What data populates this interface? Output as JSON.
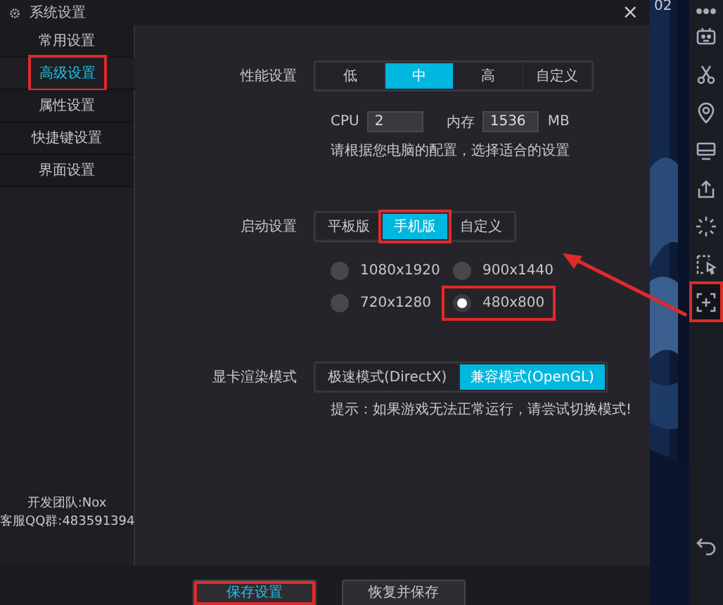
{
  "window": {
    "title": "系统设置",
    "close": "×"
  },
  "sidebar": {
    "items": [
      {
        "label": "常用设置",
        "selected": false,
        "highlighted": false
      },
      {
        "label": "高级设置",
        "selected": true,
        "highlighted": true
      },
      {
        "label": "属性设置",
        "selected": false,
        "highlighted": false
      },
      {
        "label": "快捷键设置",
        "selected": false,
        "highlighted": false
      },
      {
        "label": "界面设置",
        "selected": false,
        "highlighted": false
      }
    ],
    "team": "开发团队:Nox",
    "support": "客服QQ群:483591394"
  },
  "performance": {
    "label": "性能设置",
    "options": [
      {
        "label": "低",
        "selected": false,
        "highlighted": false
      },
      {
        "label": "中",
        "selected": true,
        "highlighted": false
      },
      {
        "label": "高",
        "selected": false,
        "highlighted": false
      },
      {
        "label": "自定义",
        "selected": false,
        "highlighted": false
      }
    ],
    "cpu_label": "CPU",
    "cpu": "2",
    "memory_label": "内存",
    "memory": "1536",
    "memory_unit": "MB",
    "hint": "请根据您电脑的配置，选择适合的设置"
  },
  "startup": {
    "label": "启动设置",
    "options": [
      {
        "label": "平板版",
        "selected": false,
        "highlighted": false
      },
      {
        "label": "手机版",
        "selected": true,
        "highlighted": true
      },
      {
        "label": "自定义",
        "selected": false,
        "highlighted": false
      }
    ],
    "resolutions": [
      {
        "label": "1080x1920",
        "selected": false,
        "highlighted": false
      },
      {
        "label": "900x1440",
        "selected": false,
        "highlighted": false
      },
      {
        "label": "720x1280",
        "selected": false,
        "highlighted": false
      },
      {
        "label": "480x800",
        "selected": true,
        "highlighted": true
      }
    ]
  },
  "render": {
    "label": "显卡渲染模式",
    "options": [
      {
        "label": "极速模式(DirectX)",
        "selected": false,
        "highlighted": false
      },
      {
        "label": "兼容模式(OpenGL)",
        "selected": true,
        "highlighted": false
      }
    ],
    "hint": "提示：如果游戏无法正常运行，请尝试切换模式!"
  },
  "buttons": [
    {
      "label": "保存设置",
      "highlighted": true
    },
    {
      "label": "恢复并保存",
      "highlighted": false
    }
  ],
  "desktop": {
    "clock": "02"
  },
  "toolbar": [
    {
      "kind": "more",
      "highlighted": false
    },
    {
      "kind": "robot",
      "highlighted": false
    },
    {
      "kind": "scissors",
      "highlighted": false
    },
    {
      "kind": "location",
      "highlighted": false
    },
    {
      "kind": "monitor",
      "highlighted": false
    },
    {
      "kind": "upload",
      "highlighted": false
    },
    {
      "kind": "sparkle",
      "highlighted": false
    },
    {
      "kind": "record",
      "highlighted": false
    },
    {
      "kind": "screenshot",
      "highlighted": true
    },
    {
      "kind": "back",
      "highlighted": false
    }
  ]
}
